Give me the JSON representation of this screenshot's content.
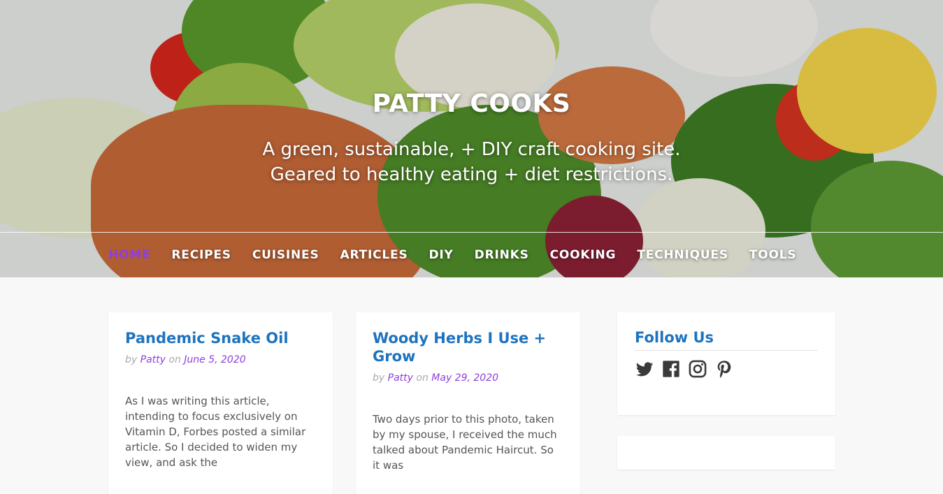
{
  "site": {
    "title": "PATTY COOKS",
    "tagline_line1": "A green, sustainable, + DIY craft cooking site.",
    "tagline_line2": "Geared to healthy eating + diet restrictions."
  },
  "nav": {
    "items": [
      "HOME",
      "RECIPES",
      "CUISINES",
      "ARTICLES",
      "DIY",
      "DRINKS",
      "COOKING",
      "TECHNIQUES",
      "TOOLS"
    ],
    "active": "HOME"
  },
  "posts": [
    {
      "title": "Pandemic Snake Oil",
      "by": "by",
      "author": "Patty",
      "on": "on",
      "date": "June 5, 2020",
      "excerpt": "As I was writing this article, intending to focus exclusively on Vitamin D, Forbes posted a similar article. So I decided to widen my view, and ask the"
    },
    {
      "title": "Woody Herbs I Use + Grow",
      "by": "by",
      "author": "Patty",
      "on": "on",
      "date": "May 29, 2020",
      "excerpt": "Two days prior to this photo, taken by my spouse, I received the much talked about Pandemic Haircut. So it was"
    }
  ],
  "sidebar": {
    "follow_title": "Follow Us",
    "social_icons": [
      "twitter-icon",
      "facebook-icon",
      "instagram-icon",
      "pinterest-icon"
    ]
  },
  "colors": {
    "link_blue": "#1e73be",
    "accent_purple": "#8e3fe0",
    "page_bg": "#f8f8f8",
    "icon_dark": "#3a3a3a"
  }
}
